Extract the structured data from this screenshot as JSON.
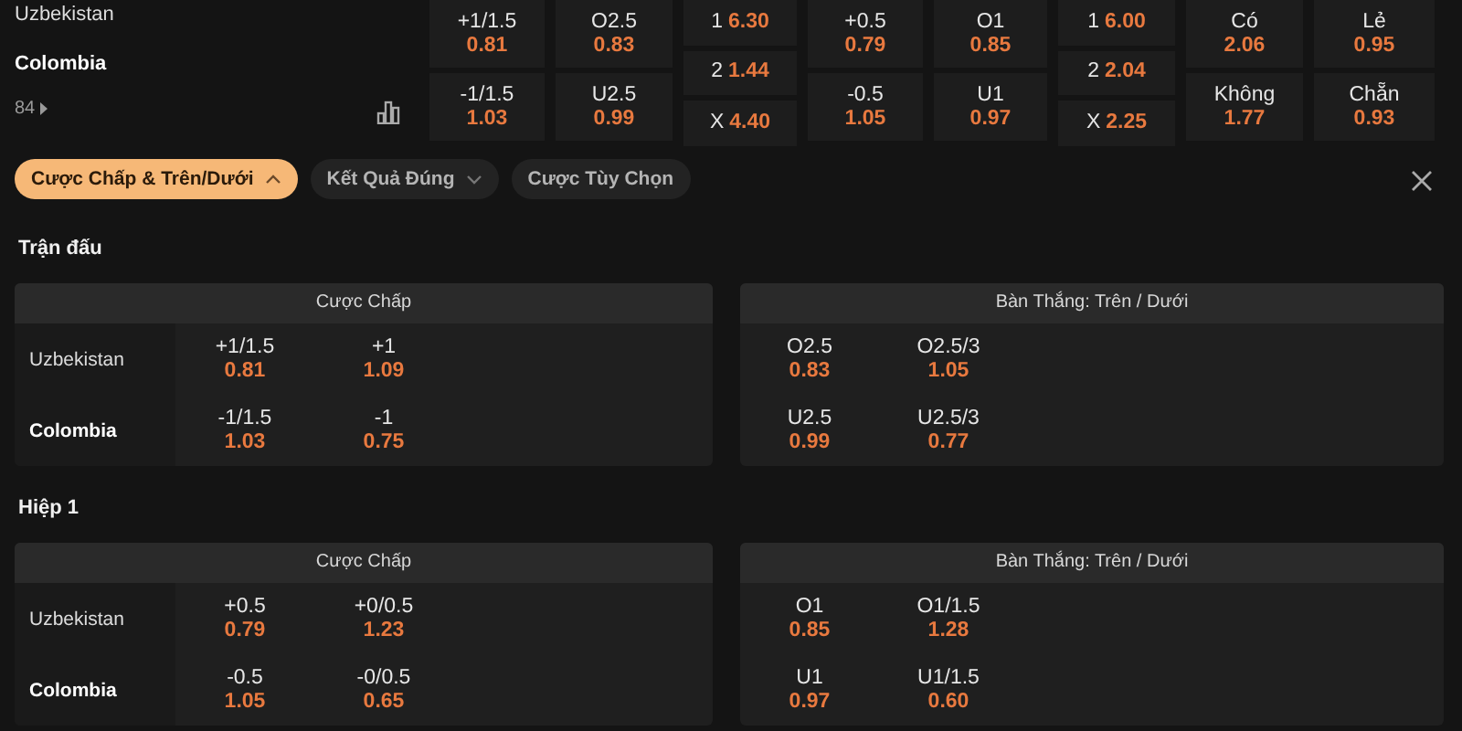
{
  "top_board": {
    "teams": [
      {
        "name": "Uzbekistan",
        "highlighted": false
      },
      {
        "name": "Colombia",
        "highlighted": true
      }
    ],
    "more_count": "84",
    "columns": [
      {
        "kind": "pair",
        "cells": [
          {
            "label": "+1/1.5",
            "odds": "0.81"
          },
          {
            "label": "-1/1.5",
            "odds": "1.03"
          }
        ]
      },
      {
        "kind": "pair",
        "cells": [
          {
            "label": "O2.5",
            "odds": "0.83"
          },
          {
            "label": "U2.5",
            "odds": "0.99"
          }
        ]
      },
      {
        "kind": "triple",
        "cells": [
          {
            "label": "1",
            "odds": "6.30"
          },
          {
            "label": "2",
            "odds": "1.44"
          },
          {
            "label": "X",
            "odds": "4.40"
          }
        ]
      },
      {
        "kind": "pair",
        "cells": [
          {
            "label": "+0.5",
            "odds": "0.79"
          },
          {
            "label": "-0.5",
            "odds": "1.05"
          }
        ]
      },
      {
        "kind": "pair",
        "cells": [
          {
            "label": "O1",
            "odds": "0.85"
          },
          {
            "label": "U1",
            "odds": "0.97"
          }
        ]
      },
      {
        "kind": "triple",
        "cells": [
          {
            "label": "1",
            "odds": "6.00"
          },
          {
            "label": "2",
            "odds": "2.04"
          },
          {
            "label": "X",
            "odds": "2.25"
          }
        ]
      },
      {
        "kind": "pair",
        "cells": [
          {
            "label": "Có",
            "odds": "2.06"
          },
          {
            "label": "Không",
            "odds": "1.77"
          }
        ]
      },
      {
        "kind": "pair",
        "cells": [
          {
            "label": "Lẻ",
            "odds": "0.95"
          },
          {
            "label": "Chẵn",
            "odds": "0.93"
          }
        ]
      }
    ]
  },
  "filters": [
    {
      "label": "Cược Chấp & Trên/Dưới",
      "selected": true,
      "kind": "dropdown",
      "expanded": true
    },
    {
      "label": "Kết Quả Đúng",
      "selected": false,
      "kind": "dropdown",
      "expanded": false
    },
    {
      "label": "Cược Tùy Chọn",
      "selected": false,
      "kind": "plain"
    }
  ],
  "sections": [
    {
      "title": "Trận đấu",
      "markets": [
        {
          "title": "Cược Chấp",
          "kind": "teams",
          "rows": [
            {
              "team": {
                "name": "Uzbekistan",
                "highlighted": false
              },
              "odds": [
                {
                  "label": "+1/1.5",
                  "odds": "0.81"
                },
                {
                  "label": "+1",
                  "odds": "1.09"
                }
              ]
            },
            {
              "team": {
                "name": "Colombia",
                "highlighted": true
              },
              "odds": [
                {
                  "label": "-1/1.5",
                  "odds": "1.03"
                },
                {
                  "label": "-1",
                  "odds": "0.75"
                }
              ]
            }
          ]
        },
        {
          "title": "Bàn Thắng: Trên / Dưới",
          "kind": "plain",
          "rows": [
            {
              "odds": [
                {
                  "label": "O2.5",
                  "odds": "0.83"
                },
                {
                  "label": "O2.5/3",
                  "odds": "1.05"
                }
              ]
            },
            {
              "odds": [
                {
                  "label": "U2.5",
                  "odds": "0.99"
                },
                {
                  "label": "U2.5/3",
                  "odds": "0.77"
                }
              ]
            }
          ]
        }
      ]
    },
    {
      "title": "Hiệp 1",
      "markets": [
        {
          "title": "Cược Chấp",
          "kind": "teams",
          "rows": [
            {
              "team": {
                "name": "Uzbekistan",
                "highlighted": false
              },
              "odds": [
                {
                  "label": "+0.5",
                  "odds": "0.79"
                },
                {
                  "label": "+0/0.5",
                  "odds": "1.23"
                }
              ]
            },
            {
              "team": {
                "name": "Colombia",
                "highlighted": true
              },
              "odds": [
                {
                  "label": "-0.5",
                  "odds": "1.05"
                },
                {
                  "label": "-0/0.5",
                  "odds": "0.65"
                }
              ]
            }
          ]
        },
        {
          "title": "Bàn Thắng: Trên / Dưới",
          "kind": "plain",
          "rows": [
            {
              "odds": [
                {
                  "label": "O1",
                  "odds": "0.85"
                },
                {
                  "label": "O1/1.5",
                  "odds": "1.28"
                }
              ]
            },
            {
              "odds": [
                {
                  "label": "U1",
                  "odds": "0.97"
                },
                {
                  "label": "U1/1.5",
                  "odds": "0.60"
                }
              ]
            }
          ]
        }
      ]
    }
  ]
}
